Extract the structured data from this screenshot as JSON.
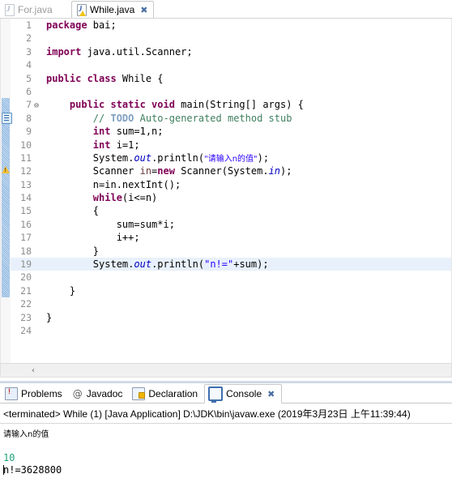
{
  "editor_tabs": [
    {
      "label": "For.java",
      "icon": "java-file-icon",
      "active": false,
      "warning": false
    },
    {
      "label": "While.java",
      "icon": "java-file-warning-icon",
      "active": true,
      "warning": true,
      "close": "✖"
    }
  ],
  "code": {
    "lines": [
      {
        "no": "1",
        "fold": "",
        "tokens": [
          {
            "t": "package",
            "c": "kw"
          },
          {
            "t": " bai;",
            "c": "pln"
          }
        ]
      },
      {
        "no": "2",
        "fold": "",
        "tokens": []
      },
      {
        "no": "3",
        "fold": "",
        "tokens": [
          {
            "t": "import",
            "c": "kw"
          },
          {
            "t": " java.util.Scanner;",
            "c": "pln"
          }
        ]
      },
      {
        "no": "4",
        "fold": "",
        "tokens": []
      },
      {
        "no": "5",
        "fold": "",
        "tokens": [
          {
            "t": "public class",
            "c": "kw"
          },
          {
            "t": " While {",
            "c": "pln"
          }
        ]
      },
      {
        "no": "6",
        "fold": "",
        "tokens": []
      },
      {
        "no": "7",
        "fold": "⊖",
        "tokens": [
          {
            "t": "    ",
            "c": "pln"
          },
          {
            "t": "public static void",
            "c": "kw"
          },
          {
            "t": " main(String[] args) {",
            "c": "pln"
          }
        ]
      },
      {
        "no": "8",
        "fold": "",
        "tokens": [
          {
            "t": "        ",
            "c": "pln"
          },
          {
            "t": "// ",
            "c": "cm"
          },
          {
            "t": "TODO",
            "c": "todo"
          },
          {
            "t": " Auto-generated method stub",
            "c": "cm"
          }
        ]
      },
      {
        "no": "9",
        "fold": "",
        "tokens": [
          {
            "t": "        ",
            "c": "pln"
          },
          {
            "t": "int",
            "c": "kw"
          },
          {
            "t": " sum=1,n;",
            "c": "pln"
          }
        ]
      },
      {
        "no": "10",
        "fold": "",
        "tokens": [
          {
            "t": "        ",
            "c": "pln"
          },
          {
            "t": "int",
            "c": "kw"
          },
          {
            "t": " i=1;",
            "c": "pln"
          }
        ]
      },
      {
        "no": "11",
        "fold": "",
        "tokens": [
          {
            "t": "        System.",
            "c": "pln"
          },
          {
            "t": "out",
            "c": "fld"
          },
          {
            "t": ".println(",
            "c": "pln"
          },
          {
            "t": "\"请输入n的值\"",
            "c": "str cjk"
          },
          {
            "t": ");",
            "c": "pln"
          }
        ]
      },
      {
        "no": "12",
        "fold": "",
        "tokens": [
          {
            "t": "        Scanner ",
            "c": "pln"
          },
          {
            "t": "in",
            "c": "lvar"
          },
          {
            "t": "=",
            "c": "pln"
          },
          {
            "t": "new",
            "c": "kw"
          },
          {
            "t": " Scanner(System.",
            "c": "pln"
          },
          {
            "t": "in",
            "c": "fld"
          },
          {
            "t": ");",
            "c": "pln"
          }
        ]
      },
      {
        "no": "13",
        "fold": "",
        "tokens": [
          {
            "t": "        n=in.nextInt();",
            "c": "pln"
          }
        ]
      },
      {
        "no": "14",
        "fold": "",
        "tokens": [
          {
            "t": "        ",
            "c": "pln"
          },
          {
            "t": "while",
            "c": "kw"
          },
          {
            "t": "(i<=n)",
            "c": "pln"
          }
        ]
      },
      {
        "no": "15",
        "fold": "",
        "tokens": [
          {
            "t": "        {",
            "c": "pln"
          }
        ]
      },
      {
        "no": "16",
        "fold": "",
        "tokens": [
          {
            "t": "            sum=sum*i;",
            "c": "pln"
          }
        ]
      },
      {
        "no": "17",
        "fold": "",
        "tokens": [
          {
            "t": "            i++;",
            "c": "pln"
          }
        ]
      },
      {
        "no": "18",
        "fold": "",
        "tokens": [
          {
            "t": "        }",
            "c": "pln"
          }
        ]
      },
      {
        "no": "19",
        "fold": "",
        "highlight": true,
        "tokens": [
          {
            "t": "        System.",
            "c": "pln"
          },
          {
            "t": "out",
            "c": "fld"
          },
          {
            "t": ".println(",
            "c": "pln"
          },
          {
            "t": "\"n!=\"",
            "c": "str"
          },
          {
            "t": "+sum);",
            "c": "pln"
          }
        ]
      },
      {
        "no": "20",
        "fold": "",
        "tokens": []
      },
      {
        "no": "21",
        "fold": "",
        "tokens": [
          {
            "t": "    }",
            "c": "pln"
          }
        ]
      },
      {
        "no": "22",
        "fold": "",
        "tokens": []
      },
      {
        "no": "23",
        "fold": "",
        "tokens": [
          {
            "t": "}",
            "c": "pln"
          }
        ]
      },
      {
        "no": "24",
        "fold": "",
        "tokens": []
      }
    ],
    "gutter_markers": [
      {
        "line": 8,
        "type": "todo-task-icon"
      },
      {
        "line": 12,
        "type": "warning-icon"
      }
    ],
    "change_bar_lines": [
      7,
      21
    ],
    "scroll_left_arrow": "‹"
  },
  "view_tabs": [
    {
      "label": "Problems",
      "icon": "problems-icon",
      "active": false
    },
    {
      "label": "Javadoc",
      "icon": "javadoc-icon",
      "active": false
    },
    {
      "label": "Declaration",
      "icon": "declaration-icon",
      "active": false
    },
    {
      "label": "Console",
      "icon": "console-icon",
      "active": true,
      "close": "✖"
    }
  ],
  "console": {
    "terminated_line": "<terminated> While (1) [Java Application] D:\\JDK\\bin\\javaw.exe (2019年3月23日 上午11:39:44)",
    "output": [
      {
        "text": "请输入n的值",
        "color": "black",
        "cjk": true
      },
      {
        "text": "",
        "color": "black"
      },
      {
        "text": "10",
        "color": "green"
      },
      {
        "text": "n!=3628800",
        "color": "black",
        "caret": true
      }
    ]
  },
  "colors": {
    "keyword": "#7f0055",
    "string": "#2a00ff",
    "comment": "#3f7f5f",
    "field": "#0000c0",
    "local_var": "#6a3e3e",
    "line_number": "#8d8d8d",
    "current_line_highlight": "#e8f1fb",
    "console_stdin": "#20a07a",
    "change_bar": "#8fb8e0"
  }
}
